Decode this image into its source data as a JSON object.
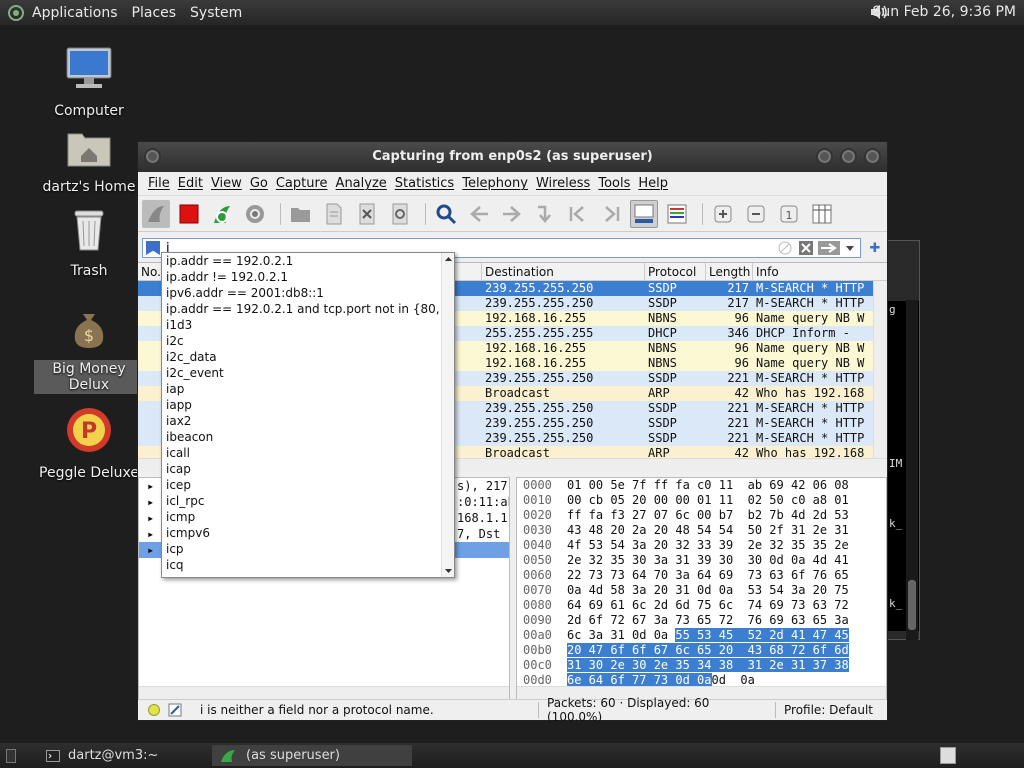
{
  "top_panel": {
    "applications": "Applications",
    "places": "Places",
    "system": "System",
    "clock": "Sun Feb 26,  9:36 PM"
  },
  "desktop_icons": [
    {
      "label": "Computer"
    },
    {
      "label": "dartz's Home"
    },
    {
      "label": "Trash"
    },
    {
      "label": "Big Money Delux"
    },
    {
      "label": "Peggle Deluxe"
    }
  ],
  "window": {
    "title": "Capturing from enp0s2 (as superuser)",
    "menu": [
      "File",
      "Edit",
      "View",
      "Go",
      "Capture",
      "Analyze",
      "Statistics",
      "Telephony",
      "Wireless",
      "Tools",
      "Help"
    ],
    "filter_value": "i"
  },
  "packet_list": {
    "columns": [
      "No.",
      "Destination",
      "Protocol",
      "Length",
      "Info"
    ],
    "rows": [
      {
        "dest": "239.255.255.250",
        "proto": "SSDP",
        "len": "217",
        "info": "M-SEARCH * HTTP"
      },
      {
        "dest": "239.255.255.250",
        "proto": "SSDP",
        "len": "217",
        "info": "M-SEARCH * HTTP"
      },
      {
        "dest": "192.168.16.255",
        "proto": "NBNS",
        "len": "96",
        "info": "Name query NB W"
      },
      {
        "dest": "255.255.255.255",
        "proto": "DHCP",
        "len": "346",
        "info": "DHCP Inform   -"
      },
      {
        "dest": "192.168.16.255",
        "proto": "NBNS",
        "len": "96",
        "info": "Name query NB W"
      },
      {
        "dest": "192.168.16.255",
        "proto": "NBNS",
        "len": "96",
        "info": "Name query NB W"
      },
      {
        "dest": "239.255.255.250",
        "proto": "SSDP",
        "len": "221",
        "info": "M-SEARCH * HTTP"
      },
      {
        "dest": "Broadcast",
        "proto": "ARP",
        "len": "42",
        "info": "Who has 192.168"
      },
      {
        "dest": "239.255.255.250",
        "proto": "SSDP",
        "len": "221",
        "info": "M-SEARCH * HTTP"
      },
      {
        "dest": "239.255.255.250",
        "proto": "SSDP",
        "len": "221",
        "info": "M-SEARCH * HTTP"
      },
      {
        "dest": "239.255.255.250",
        "proto": "SSDP",
        "len": "221",
        "info": "M-SEARCH * HTTP"
      },
      {
        "dest": "Broadcast",
        "proto": "ARP",
        "len": "42",
        "info": "Who has 192.168"
      }
    ]
  },
  "details": [
    "s), 217",
    ":0:11:ab",
    "168.1.1",
    "7, Dst",
    ""
  ],
  "bytes": [
    {
      "off": "0000",
      "hex": "01 00 5e 7f ff fa c0 11  ab 69 42 06 08"
    },
    {
      "off": "0010",
      "hex": "00 cb 05 20 00 00 01 11  02 50 c0 a8 01"
    },
    {
      "off": "0020",
      "hex": "ff fa f3 27 07 6c 00 b7  b2 7b 4d 2d 53"
    },
    {
      "off": "0030",
      "hex": "43 48 20 2a 20 48 54 54  50 2f 31 2e 31"
    },
    {
      "off": "0040",
      "hex": "4f 53 54 3a 20 32 33 39  2e 32 35 35 2e"
    },
    {
      "off": "0050",
      "hex": "2e 32 35 30 3a 31 39 30  30 0d 0a 4d 41"
    },
    {
      "off": "0060",
      "hex": "22 73 73 64 70 3a 64 69  73 63 6f 76 65"
    },
    {
      "off": "0070",
      "hex": "0a 4d 58 3a 20 31 0d 0a  53 54 3a 20 75"
    },
    {
      "off": "0080",
      "hex": "64 69 61 6c 2d 6d 75 6c  74 69 73 63 72"
    },
    {
      "off": "0090",
      "hex": "2d 6f 72 67 3a 73 65 72  76 69 63 65 3a"
    },
    {
      "off": "00a0",
      "hex_plain": "6c 3a 31 0d 0a ",
      "hex_hl": "55 53 45  52 2d 41 47 45"
    },
    {
      "off": "00b0",
      "hex_hl": "20 47 6f 6f 67 6c 65 20  43 68 72 6f 6d"
    },
    {
      "off": "00c0",
      "hex_hl": "31 30 2e 30 2e 35 34 38  31 2e 31 37 38"
    },
    {
      "off": "00d0",
      "hex_hl": "6e 64 6f 77 73 0d 0a",
      "hex_plain": "0d  0a"
    }
  ],
  "autocomplete": [
    "ip.addr == 192.0.2.1",
    "ip.addr != 192.0.2.1",
    "ipv6.addr == 2001:db8::1",
    "ip.addr == 192.0.2.1 and tcp.port not in {80, 25}",
    "i1d3",
    "i2c",
    "i2c_data",
    "i2c_event",
    "iap",
    "iapp",
    "iax2",
    "ibeacon",
    "icall",
    "icap",
    "icep",
    "icl_rpc",
    "icmp",
    "icmpv6",
    "icp",
    "icq"
  ],
  "status": {
    "message": "i is neither a field nor a protocol name.",
    "packets": "Packets: 60 · Displayed: 60 (100.0%)",
    "profile": "Profile: Default"
  },
  "bg_terminal": [
    "g",
    "IM",
    "k_",
    "k_"
  ],
  "taskbar": [
    {
      "label": "dartz@vm3:~"
    },
    {
      "label": "(as superuser)"
    }
  ],
  "colors": {
    "selection": "#3c7fd0",
    "ssdp_row": "#dae8f8",
    "nbns_row": "#fdf8d4",
    "dhcp_row": "#dae8f8",
    "arp_row": "#fbf1d0"
  }
}
